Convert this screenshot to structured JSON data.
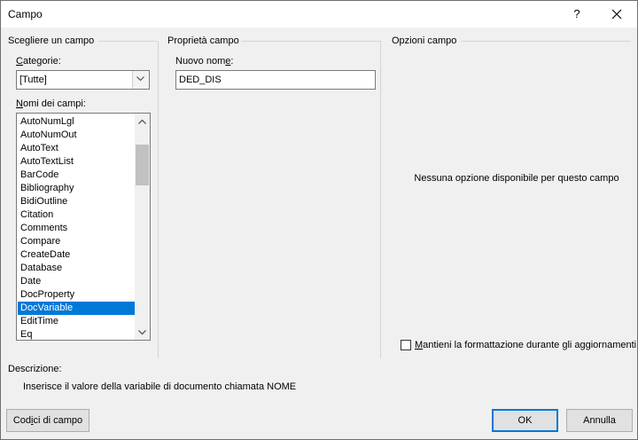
{
  "window": {
    "title": "Campo",
    "help_label": "?",
    "close_label": "✕"
  },
  "left_panel": {
    "title": "Scegliere un campo",
    "categories_label_prefix": "",
    "categories_label_u": "C",
    "categories_label_rest": "ategorie:",
    "categories_value": "[Tutte]",
    "fields_label_u": "N",
    "fields_label_rest": "omi dei campi:",
    "fields": [
      "AutoNumLgl",
      "AutoNumOut",
      "AutoText",
      "AutoTextList",
      "BarCode",
      "Bibliography",
      "BidiOutline",
      "Citation",
      "Comments",
      "Compare",
      "CreateDate",
      "Database",
      "Date",
      "DocProperty",
      "DocVariable",
      "EditTime",
      "Eq"
    ],
    "selected_field": "DocVariable"
  },
  "middle_panel": {
    "title": "Proprietà campo",
    "name_label_pre": "Nuovo nom",
    "name_label_u": "e",
    "name_label_post": ":",
    "name_value": "DED_DIS"
  },
  "right_panel": {
    "title": "Opzioni campo",
    "no_options": "Nessuna opzione disponibile per questo campo",
    "preserve_label_u": "M",
    "preserve_label_rest": "antieni la formattazione durante gli aggiornamenti",
    "preserve_checked": false
  },
  "description": {
    "title": "Descrizione:",
    "text": "Inserisce il valore della variabile di documento chiamata NOME"
  },
  "buttons": {
    "field_codes_pre": "Cod",
    "field_codes_u": "i",
    "field_codes_post": "ci di campo",
    "ok": "OK",
    "cancel": "Annulla"
  }
}
